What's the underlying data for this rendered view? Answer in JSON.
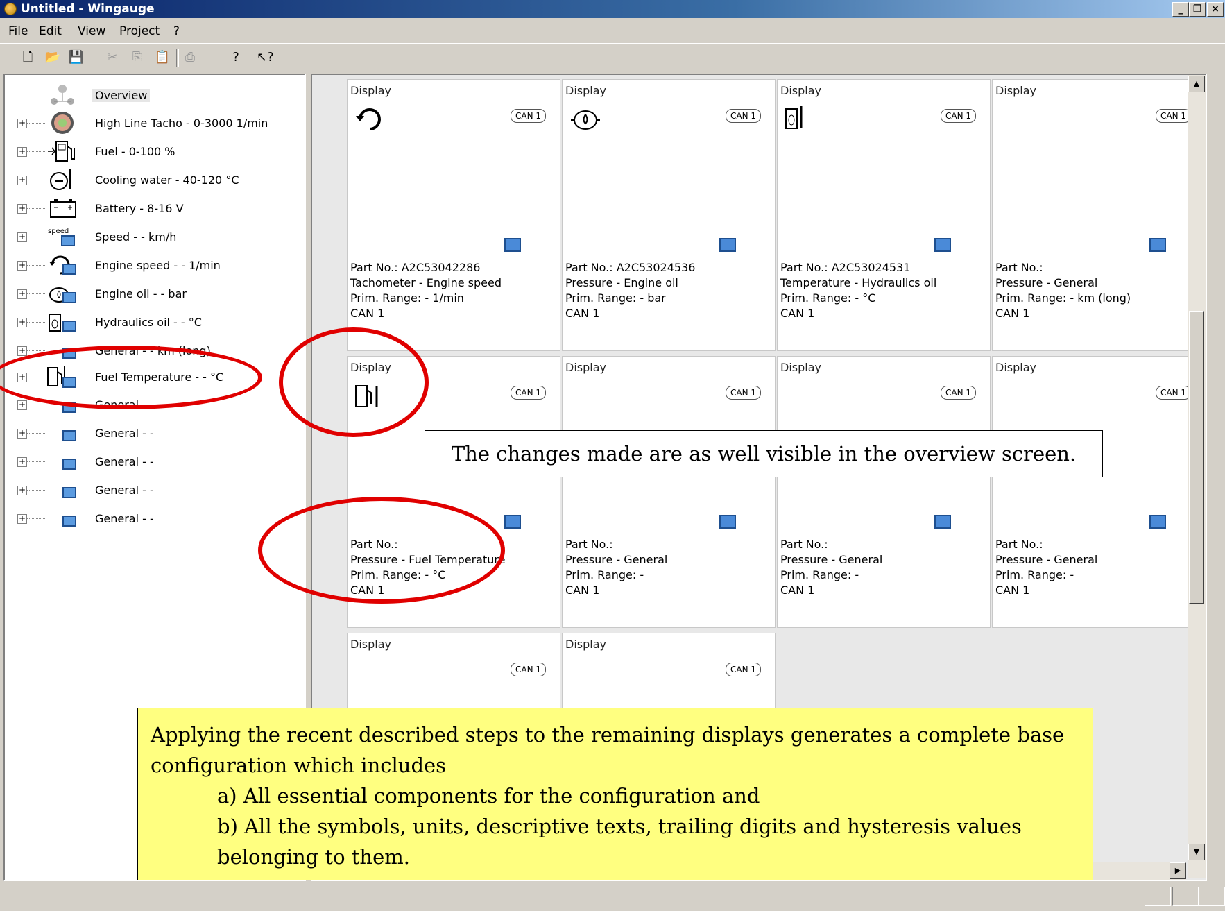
{
  "window": {
    "title": "Untitled - Wingauge",
    "minimize": "_",
    "maximize": "❐",
    "close": "×"
  },
  "menu": [
    "File",
    "Edit",
    "View",
    "Project",
    "?"
  ],
  "toolbar": {
    "items": [
      {
        "icon": "new-icon",
        "glyph": "🗋"
      },
      {
        "icon": "open-icon",
        "glyph": "📂"
      },
      {
        "icon": "save-icon",
        "glyph": "💾"
      },
      {
        "icon": "cut-icon",
        "glyph": "✂"
      },
      {
        "icon": "copy-icon",
        "glyph": "⎘"
      },
      {
        "icon": "paste-icon",
        "glyph": "📋"
      },
      {
        "icon": "print-icon",
        "glyph": "⎙"
      },
      {
        "icon": "help-icon",
        "glyph": "?"
      },
      {
        "icon": "context-help-icon",
        "glyph": "↖?"
      }
    ]
  },
  "tree": {
    "items": [
      {
        "label": "Overview",
        "icon": "overview-icon"
      },
      {
        "label": "High Line Tacho - 0-3000 1/min",
        "icon": "tacho-gauge-icon"
      },
      {
        "label": "Fuel - 0-100 %",
        "icon": "fuel-pump-icon"
      },
      {
        "label": "Cooling water - 40-120 °C",
        "icon": "coolant-temp-icon"
      },
      {
        "label": "Battery - 8-16 V",
        "icon": "battery-icon"
      },
      {
        "label": "Speed - - km/h",
        "icon": "speed-icon"
      },
      {
        "label": "Engine speed - - 1/min",
        "icon": "engine-speed-icon"
      },
      {
        "label": "Engine oil - - bar",
        "icon": "oil-can-icon"
      },
      {
        "label": "Hydraulics oil - - °C",
        "icon": "hydraulic-oil-icon"
      },
      {
        "label": "General - - km (long)",
        "icon": "display-icon"
      },
      {
        "label": "Fuel Temperature - - °C",
        "icon": "fuel-temperature-icon"
      },
      {
        "label": "General - -",
        "icon": "display-icon"
      },
      {
        "label": "General - -",
        "icon": "display-icon"
      },
      {
        "label": "General - -",
        "icon": "display-icon"
      },
      {
        "label": "General - -",
        "icon": "display-icon"
      },
      {
        "label": "General - -",
        "icon": "display-icon"
      }
    ]
  },
  "cards": [
    {
      "title": "Display",
      "can": "CAN 1",
      "symbol": "engine-speed-icon",
      "part": "Part No.: A2C53042286",
      "desc": "Tachometer - Engine speed",
      "range": "Prim. Range: - 1/min",
      "bus": "CAN 1"
    },
    {
      "title": "Display",
      "can": "CAN 1",
      "symbol": "oil-can-icon",
      "part": "Part No.: A2C53024536",
      "desc": "Pressure - Engine oil",
      "range": "Prim. Range: - bar",
      "bus": "CAN 1"
    },
    {
      "title": "Display",
      "can": "CAN 1",
      "symbol": "hydraulic-oil-icon",
      "part": "Part No.: A2C53024531",
      "desc": "Temperature - Hydraulics oil",
      "range": "Prim. Range: - °C",
      "bus": "CAN 1"
    },
    {
      "title": "Display",
      "can": "CAN 1",
      "symbol": "",
      "part": "Part No.:",
      "desc": "Pressure - General",
      "range": "Prim. Range: - km (long)",
      "bus": "CAN 1"
    },
    {
      "title": "Display",
      "can": "CAN 1",
      "symbol": "fuel-temperature-icon",
      "part": "Part No.:",
      "desc": "Pressure - Fuel Temperature",
      "range": "Prim. Range: - °C",
      "bus": "CAN 1"
    },
    {
      "title": "Display",
      "can": "CAN 1",
      "symbol": "",
      "part": "Part No.:",
      "desc": "Pressure - General",
      "range": "Prim. Range: -",
      "bus": "CAN 1"
    },
    {
      "title": "Display",
      "can": "CAN 1",
      "symbol": "",
      "part": "Part No.:",
      "desc": "Pressure - General",
      "range": "Prim. Range: -",
      "bus": "CAN 1"
    },
    {
      "title": "Display",
      "can": "CAN 1",
      "symbol": "",
      "part": "Part No.:",
      "desc": "Pressure - General",
      "range": "Prim. Range: -",
      "bus": "CAN 1"
    },
    {
      "title": "Display",
      "can": "CAN 1",
      "symbol": "",
      "part": "",
      "desc": "",
      "range": "",
      "bus": ""
    },
    {
      "title": "Display",
      "can": "CAN 1",
      "symbol": "",
      "part": "",
      "desc": "",
      "range": "",
      "bus": ""
    }
  ],
  "callout": "The changes made are as well visible in the overview screen.",
  "note": {
    "line1": "Applying the recent described steps to the remaining displays generates a complete base configuration which includes",
    "a": "a) All essential components for the configuration and",
    "b": "b) All the symbols, units, descriptive texts, trailing digits and hysteresis values belonging to them."
  }
}
